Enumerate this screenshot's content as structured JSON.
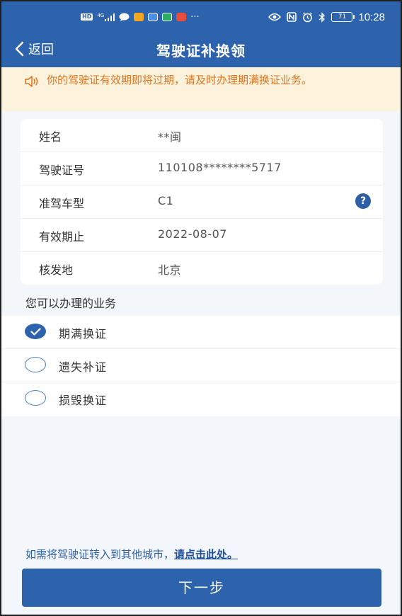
{
  "status_bar": {
    "network_label": "HD",
    "signal_label": "4G",
    "more": "···",
    "battery": "71",
    "time": "10:28"
  },
  "nav": {
    "back_label": "返回",
    "title": "驾驶证补换领"
  },
  "notice": {
    "text": "你的驾驶证有效期即将过期，请及时办理期满换证业务。"
  },
  "license_info": [
    {
      "label": "姓名",
      "value": "**闽"
    },
    {
      "label": "驾驶证号",
      "value": "110108********5717"
    },
    {
      "label": "准驾车型",
      "value": "C1"
    },
    {
      "label": "有效期止",
      "value": "2022-08-07"
    },
    {
      "label": "核发地",
      "value": "北京"
    }
  ],
  "help_icon_label": "?",
  "services": {
    "heading": "您可以办理的业务",
    "options": [
      {
        "label": "期满换证",
        "selected": true
      },
      {
        "label": "遗失补证",
        "selected": false
      },
      {
        "label": "损毁换证",
        "selected": false
      }
    ]
  },
  "transfer": {
    "text": "如需将驾驶证转入到其他城市，",
    "link": "请点击此处。"
  },
  "next_button": "下一步",
  "colors": {
    "primary": "#2d63ad",
    "notice_bg": "#fdf3dc",
    "notice_text": "#e0731e",
    "page_bg": "#f3f6fb"
  },
  "icons": {
    "back": "chevron-left-icon",
    "notice": "speaker-icon",
    "help": "question-circle-icon",
    "check": "check-icon"
  }
}
